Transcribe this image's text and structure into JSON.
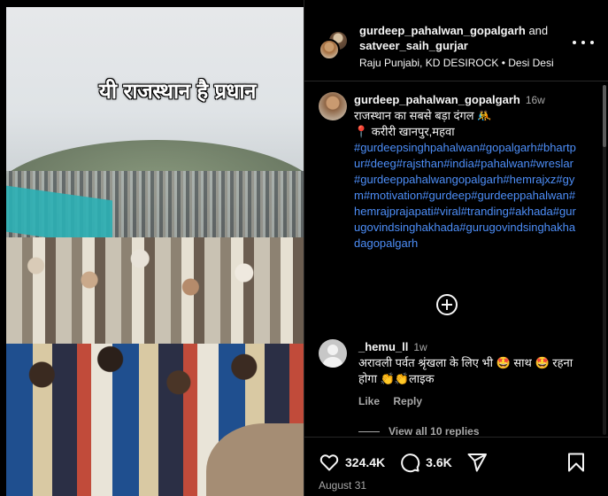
{
  "media": {
    "overlay_text": "यी राजस्थान है प्रधान"
  },
  "header": {
    "user1": "gurdeep_pahalwan_gopalgarh",
    "and": "and",
    "user2": "satveer_saih_gurjar",
    "audio": "Raju Punjabi, KD DESIROCK • Desi Desi",
    "more_icon": "more-horizontal-icon"
  },
  "caption": {
    "username": "gurdeep_pahalwan_gopalgarh",
    "time": "16w",
    "line1": "राजस्थान का सबसे बड़ा दंगल 🤼",
    "line2": "📍 करीरी खानपुर,महवा",
    "hashtags": "#gurdeepsinghpahalwan#gopalgarh#bhartpur#deeg#rajsthan#india#pahalwan#wreslar#gurdeeppahalwangopalgarh#hemrajxz#gym#motivation#gurdeep#gurdeeppahalwan#hemrajprajapati#viral#tranding#akhada#gurugovindsinghakhada#gurugovindsinghakhadagopalgarh"
  },
  "load_more_icon": "plus-circle-icon",
  "comment": {
    "username": "_hemu_ll",
    "time": "1w",
    "text": "अरावली पर्वत श्रृंखला के लिए भी 🤩 साथ 🤩 रहना होगा 👏👏लाइक",
    "like_label": "Like",
    "reply_label": "Reply",
    "view_replies": "View all 10 replies"
  },
  "footer": {
    "likes": "324.4K",
    "comments": "3.6K",
    "date": "August 31",
    "icons": [
      "heart-icon",
      "comment-icon",
      "share-icon",
      "bookmark-icon"
    ]
  }
}
